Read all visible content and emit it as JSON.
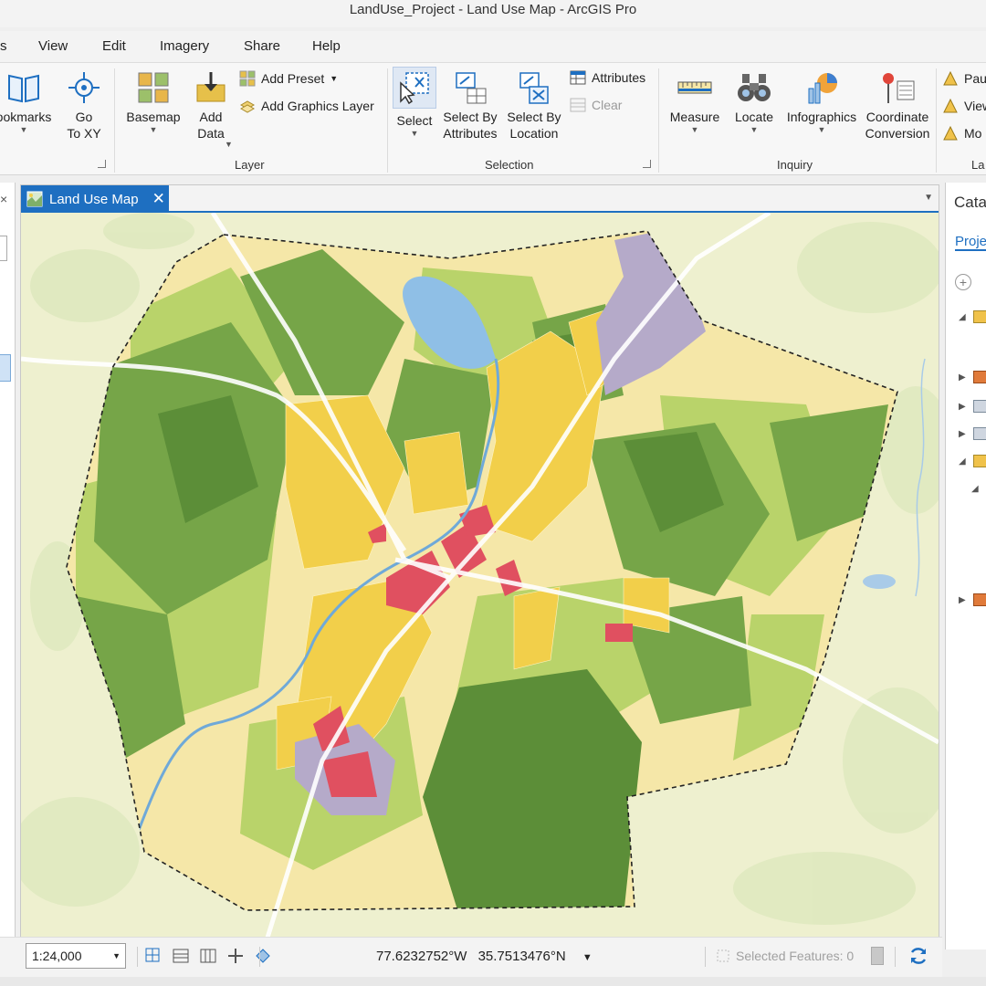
{
  "window": {
    "title": "LandUse_Project - Land Use Map - ArcGIS Pro"
  },
  "menu": {
    "items": [
      "s",
      "View",
      "Edit",
      "Imagery",
      "Share",
      "Help"
    ]
  },
  "ribbon": {
    "bookmarks": "ookmarks",
    "go_to_xy": "Go\nTo XY",
    "basemap": "Basemap",
    "add_data": "Add\nData",
    "add_preset": "Add Preset",
    "add_graphics_layer": "Add Graphics Layer",
    "layer_group": "Layer",
    "select": "Select",
    "select_by_attributes": "Select By\nAttributes",
    "select_by_location": "Select By\nLocation",
    "attributes": "Attributes",
    "clear": "Clear",
    "selection_group": "Selection",
    "measure": "Measure",
    "locate": "Locate",
    "infographics": "Infographics",
    "coordinate_conversion": "Coordinate\nConversion",
    "inquiry_group": "Inquiry",
    "pause": "Pau",
    "view": "View",
    "more": "Mo",
    "la_group": "La"
  },
  "tab": {
    "label": "Land Use Map"
  },
  "catalog": {
    "title": "Cata",
    "project_tab": "Proje"
  },
  "status": {
    "scale": "1:24,000",
    "longitude": "77.6232752°W",
    "latitude": "35.7513476°N",
    "selected_features": "Selected Features: 0"
  },
  "colors": {
    "accent": "#1e6fc1",
    "commercial": "#e05060",
    "residential": "#f2cf4a",
    "industrial": "#b5aac9",
    "forest": "#6f9e44",
    "agriculture": "#a9c95a",
    "water": "#8fbfe6"
  }
}
